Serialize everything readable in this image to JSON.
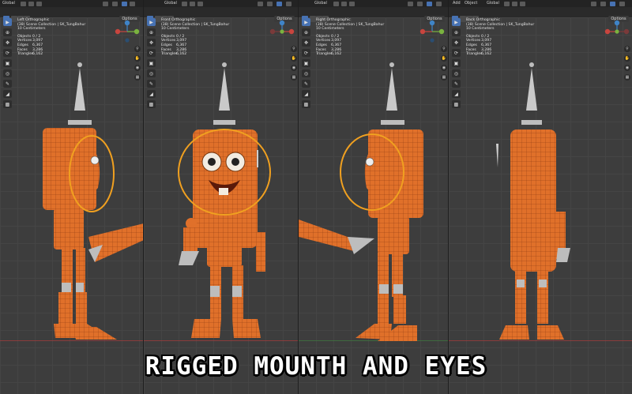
{
  "viewports": [
    {
      "id": "left",
      "view_name": "Left Orthographic",
      "collection": "(38) Scene Collection | SK_TungBahur",
      "scale": "10 Centimeters",
      "orientation_label": "Global",
      "options_label": "Options",
      "stats": [
        {
          "k": "Objects",
          "v": "0 / 2"
        },
        {
          "k": "Vertices",
          "v": "3,097"
        },
        {
          "k": "Edges",
          "v": "6,367"
        },
        {
          "k": "Faces",
          "v": "3,286"
        },
        {
          "k": "Triangles",
          "v": "6,162"
        }
      ]
    },
    {
      "id": "front",
      "view_name": "Front Orthographic",
      "collection": "(38) Scene Collection | SK_TungBahur",
      "scale": "10 Centimeters",
      "orientation_label": "Global",
      "options_label": "Options",
      "stats": [
        {
          "k": "Objects",
          "v": "0 / 2"
        },
        {
          "k": "Vertices",
          "v": "3,097"
        },
        {
          "k": "Edges",
          "v": "6,367"
        },
        {
          "k": "Faces",
          "v": "3,286"
        },
        {
          "k": "Triangles",
          "v": "6,162"
        }
      ]
    },
    {
      "id": "right",
      "view_name": "Right Orthographic",
      "collection": "(38) Scene Collection | SK_TungBahur",
      "scale": "10 Centimeters",
      "orientation_label": "Global",
      "options_label": "Options",
      "stats": [
        {
          "k": "Objects",
          "v": "0 / 2"
        },
        {
          "k": "Vertices",
          "v": "3,097"
        },
        {
          "k": "Edges",
          "v": "6,367"
        },
        {
          "k": "Faces",
          "v": "3,286"
        },
        {
          "k": "Triangles",
          "v": "6,162"
        }
      ]
    },
    {
      "id": "back",
      "view_name": "Back Orthographic",
      "collection": "(38) Scene Collection | SK_TungBahur",
      "scale": "10 Centimeters",
      "orientation_label": "Global",
      "options_label": "Options",
      "stats": [
        {
          "k": "Objects",
          "v": "0 / 2"
        },
        {
          "k": "Vertices",
          "v": "3,097"
        },
        {
          "k": "Edges",
          "v": "6,367"
        },
        {
          "k": "Faces",
          "v": "3,286"
        },
        {
          "k": "Triangles",
          "v": "6,162"
        }
      ]
    }
  ],
  "header_menus": {
    "back_add": "Add",
    "back_object": "Object"
  },
  "gizmo_axes": {
    "x": "X",
    "y": "Y",
    "z": "Z"
  },
  "colors": {
    "body_orange": "#e0702a",
    "body_dark": "#a84a15",
    "annotation": "#f0a020",
    "selected": "#4772b3",
    "x_axis": "#c8453e",
    "y_axis": "#7ab33f",
    "z_axis": "#3f84c8"
  },
  "caption": "RIGGED MOUNTH AND EYES"
}
